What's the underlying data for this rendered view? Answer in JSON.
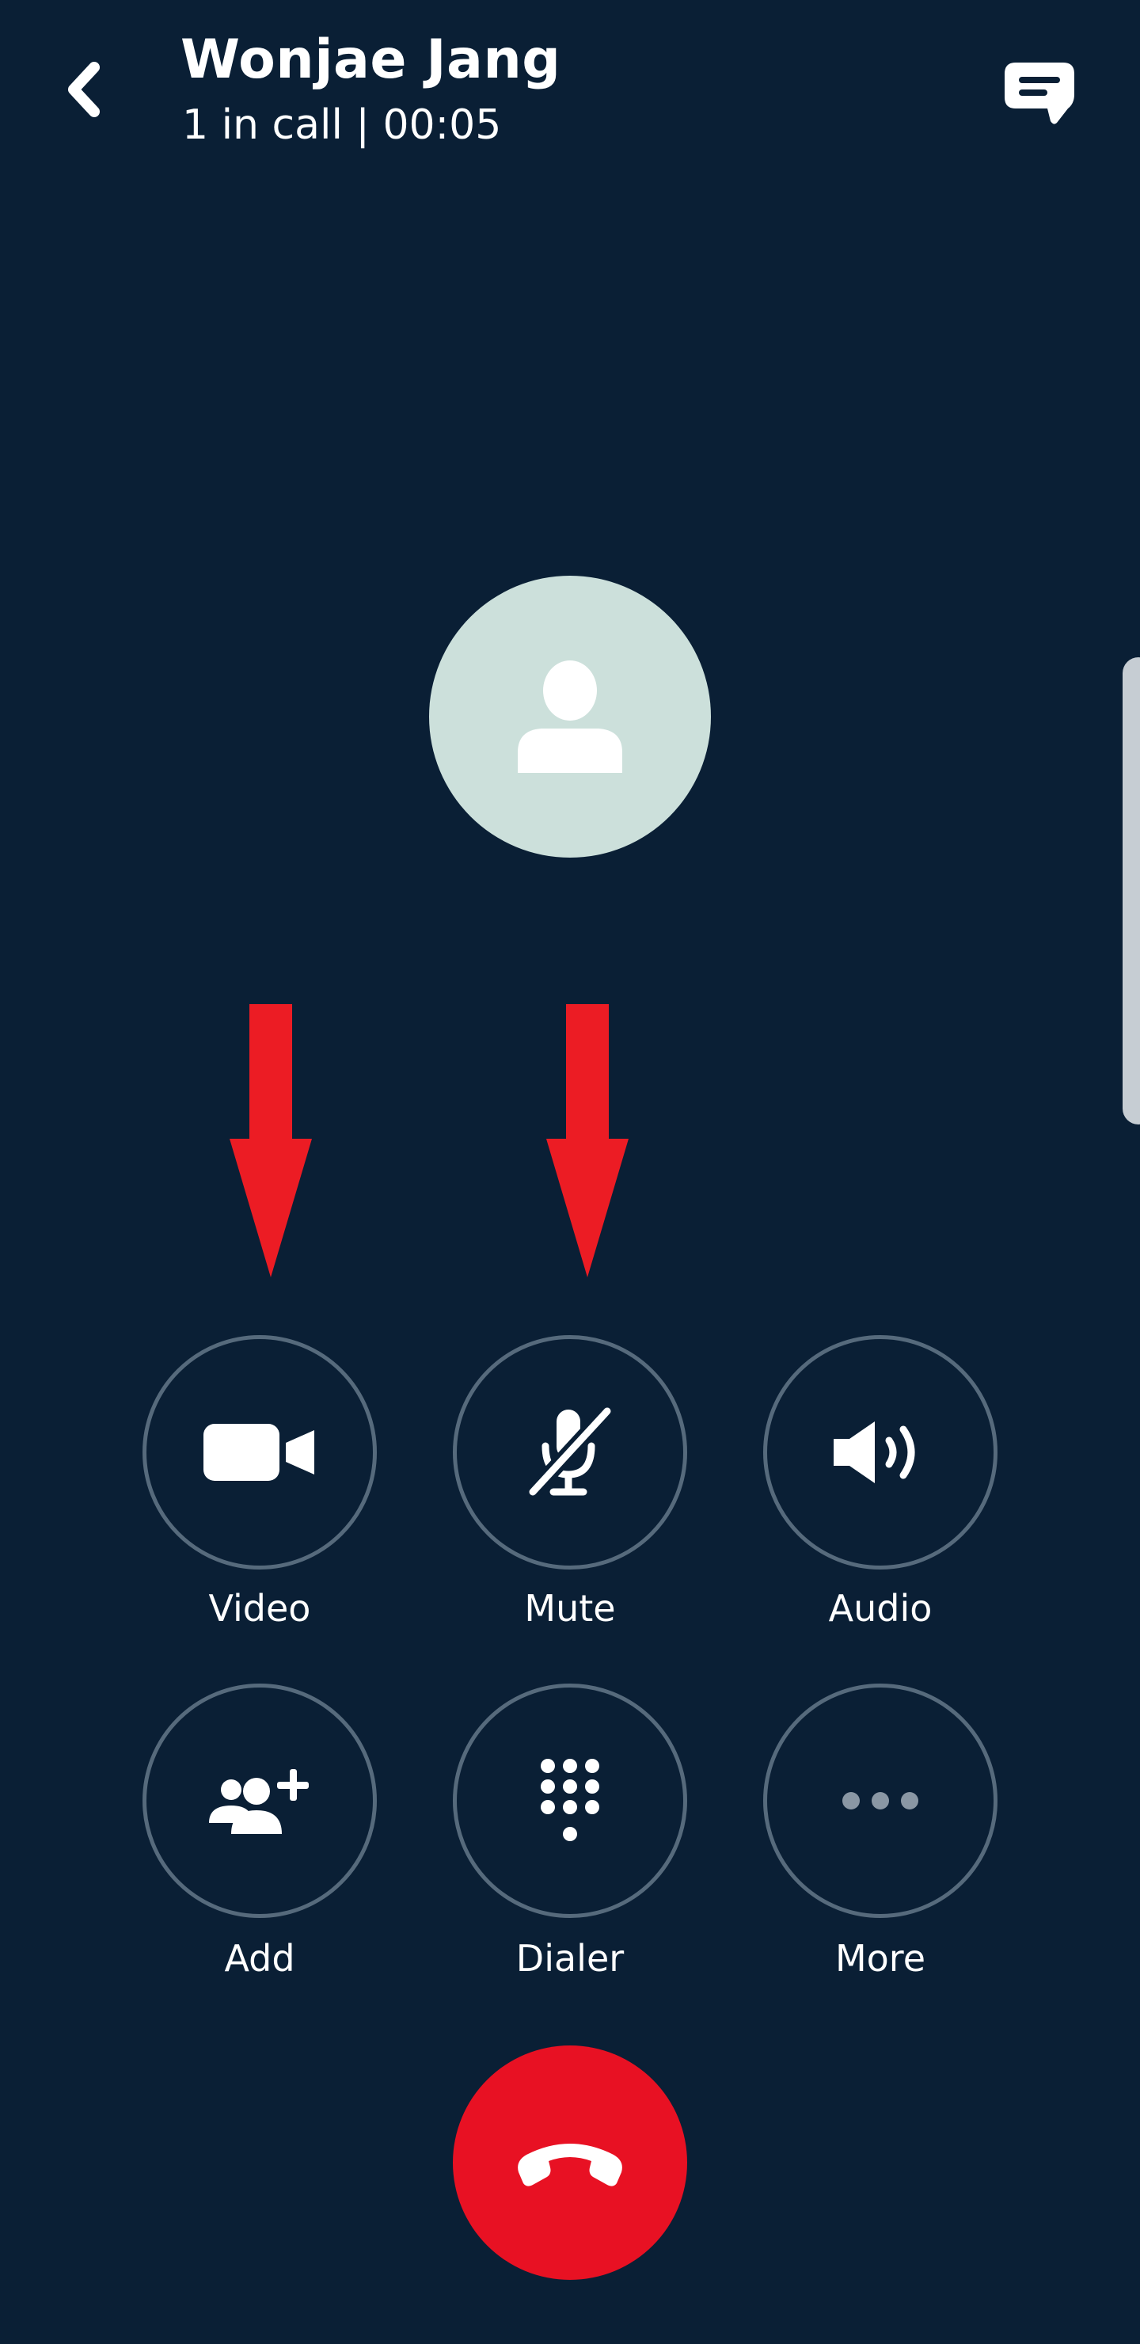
{
  "header": {
    "contact_name": "Wonjae Jang",
    "call_status": "1 in call | 00:05",
    "back_icon": "chevron-left-icon",
    "chat_icon": "chat-bubble-icon"
  },
  "avatar": {
    "icon": "person-icon",
    "background_color": "#cce0db"
  },
  "controls": {
    "row1": [
      {
        "label": "Video",
        "icon": "video-camera-icon"
      },
      {
        "label": "Mute",
        "icon": "microphone-off-icon"
      },
      {
        "label": "Audio",
        "icon": "speaker-icon"
      }
    ],
    "row2": [
      {
        "label": "Add",
        "icon": "add-people-icon"
      },
      {
        "label": "Dialer",
        "icon": "dialpad-icon"
      },
      {
        "label": "More",
        "icon": "more-dots-icon"
      }
    ]
  },
  "end_call": {
    "icon": "hang-up-icon",
    "color": "#e81123"
  },
  "annotations": {
    "arrow_color": "#ec1c24"
  },
  "colors": {
    "background": "#0a1f35",
    "button_ring": "#566a7c"
  }
}
